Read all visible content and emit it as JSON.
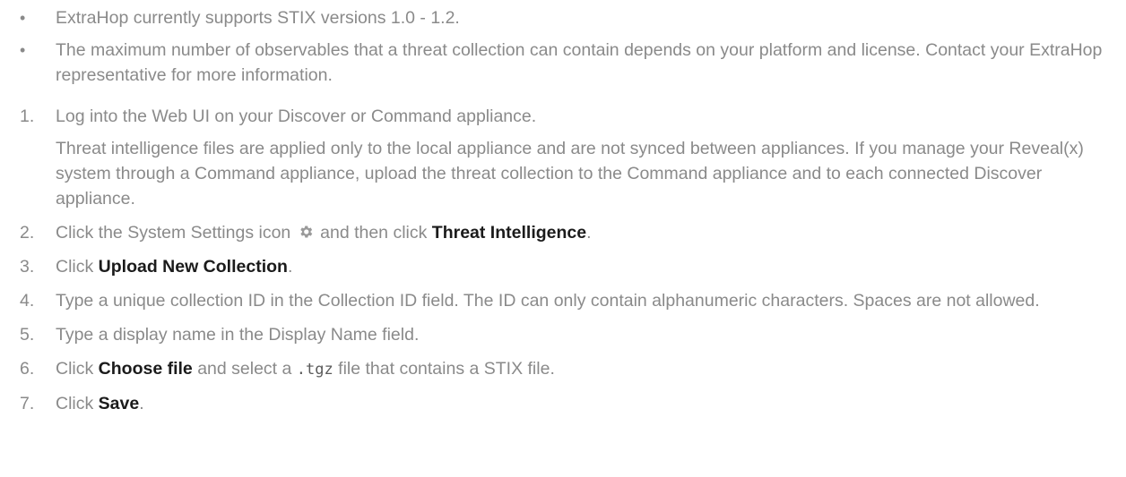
{
  "bullets": [
    "ExtraHop currently supports STIX versions 1.0 - 1.2.",
    "The maximum number of observables that a threat collection can contain depends on your platform and license. Contact your ExtraHop representative for more information."
  ],
  "bullet_glyph": "•",
  "steps": {
    "s1": {
      "num": "1.",
      "text": "Log into the Web UI on your Discover or Command appliance.",
      "note": "Threat intelligence files are applied only to the local appliance and are not synced between appliances. If you manage your Reveal(x) system through a Command appliance, upload the threat collection to the Command appliance and to each connected Discover appliance."
    },
    "s2": {
      "num": "2.",
      "pre": "Click the System Settings icon",
      "icon": "gear-icon",
      "mid": "and then click",
      "bold": "Threat Intelligence",
      "post": "."
    },
    "s3": {
      "num": "3.",
      "pre": "Click",
      "bold": "Upload New Collection",
      "post": "."
    },
    "s4": {
      "num": "4.",
      "text": "Type a unique collection ID in the Collection ID field. The ID can only contain alphanumeric characters. Spaces are not allowed."
    },
    "s5": {
      "num": "5.",
      "text": "Type a display name in the Display Name field."
    },
    "s6": {
      "num": "6.",
      "pre": "Click",
      "bold": "Choose file",
      "mid": "and select a",
      "code": ".tgz",
      "post": "file that contains a STIX file."
    },
    "s7": {
      "num": "7.",
      "pre": "Click",
      "bold": "Save",
      "post": "."
    }
  },
  "colors": {
    "text": "#8a8a8a",
    "emphasis": "#1b1b1b",
    "icon": "#9a9a9a"
  }
}
